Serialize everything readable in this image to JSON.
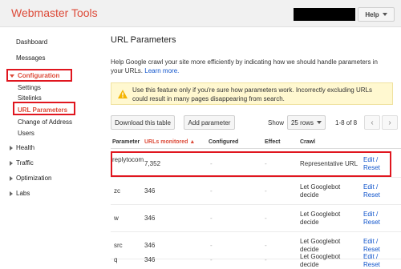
{
  "app": {
    "title": "Webmaster Tools",
    "help_label": "Help"
  },
  "sidebar": {
    "dashboard": "Dashboard",
    "messages": "Messages",
    "configuration": "Configuration",
    "settings": "Settings",
    "sitelinks": "Sitelinks",
    "url_parameters": "URL Parameters",
    "change_of_address": "Change of Address",
    "users": "Users",
    "health": "Health",
    "traffic": "Traffic",
    "optimization": "Optimization",
    "labs": "Labs"
  },
  "page": {
    "title": "URL Parameters",
    "intro": "Help Google crawl your site more efficiently by indicating how we should handle parameters in your URLs.",
    "learn_more": "Learn more.",
    "warning": "Use this feature only if you're sure how parameters work. Incorrectly excluding URLs could result in many pages disappearing from search."
  },
  "toolbar": {
    "download": "Download this table",
    "add": "Add parameter",
    "show_label": "Show",
    "rows_value": "25 rows",
    "range": "1-8 of 8",
    "prev_glyph": "‹",
    "next_glyph": "›"
  },
  "table": {
    "columns": [
      "Parameter",
      "URLs monitored ▲",
      "Configured",
      "Effect",
      "Crawl"
    ],
    "rows": [
      {
        "parameter": "replytocom",
        "urls": "7,352",
        "configured": "-",
        "effect": "-",
        "crawl": "Representative URL",
        "edit": "Edit /",
        "reset": "Reset"
      },
      {
        "parameter": "zc",
        "urls": "346",
        "configured": "-",
        "effect": "-",
        "crawl": "Let Googlebot decide",
        "edit": "Edit /",
        "reset": "Reset"
      },
      {
        "parameter": "w",
        "urls": "346",
        "configured": "-",
        "effect": "-",
        "crawl": "Let Googlebot decide",
        "edit": "Edit /",
        "reset": "Reset"
      },
      {
        "parameter": "src",
        "urls": "346",
        "configured": "-",
        "effect": "-",
        "crawl": "Let Googlebot decide",
        "edit": "Edit /",
        "reset": "Reset"
      },
      {
        "parameter": "q",
        "urls": "346",
        "configured": "-",
        "effect": "-",
        "crawl": "Let Googlebot decide",
        "edit": "Edit /",
        "reset": "Reset"
      }
    ]
  },
  "colors": {
    "brand": "#dd4b39",
    "highlight": "#e0161f",
    "link": "#1155cc",
    "warning_bg": "#fff8d0"
  },
  "icons": {
    "warning": "warning-triangle-icon",
    "expand": "triangle-right-icon",
    "collapse": "triangle-down-icon"
  }
}
